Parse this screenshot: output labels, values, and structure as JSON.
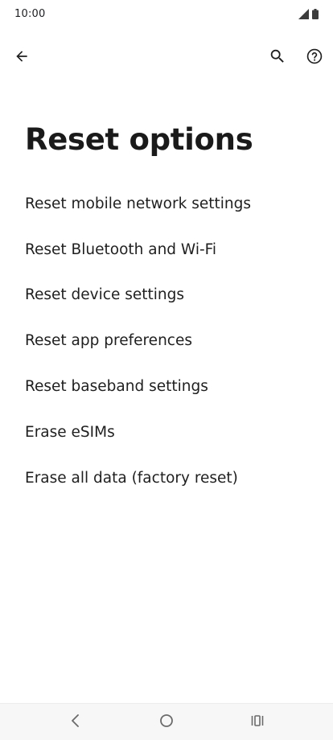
{
  "status_bar": {
    "time": "10:00",
    "icons": [
      "signal-icon",
      "battery-icon"
    ]
  },
  "toolbar": {
    "icons": [
      "back-arrow-icon",
      "search-icon",
      "help-icon"
    ]
  },
  "page": {
    "title": "Reset options"
  },
  "options": [
    {
      "label": "Reset mobile network settings"
    },
    {
      "label": "Reset Bluetooth and Wi-Fi"
    },
    {
      "label": "Reset device settings"
    },
    {
      "label": "Reset app preferences"
    },
    {
      "label": "Reset baseband settings"
    },
    {
      "label": "Erase eSIMs"
    },
    {
      "label": "Erase all data (factory reset)"
    }
  ],
  "nav_bar": {
    "icons": [
      "nav-back-icon",
      "home-icon",
      "recents-icon"
    ]
  },
  "colors": {
    "background": "#ffffff",
    "text": "#1f1f1f",
    "nav_bar": "#f7f7f7"
  }
}
